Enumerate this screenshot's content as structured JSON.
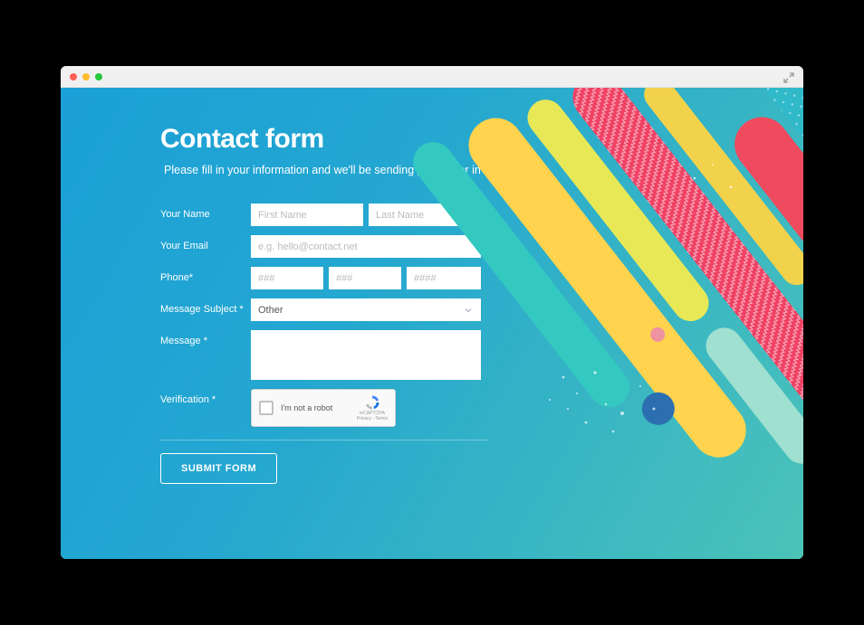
{
  "header": {
    "title": "Contact form",
    "subtitle": "Please fill in your information and we'll be sending your order in no time."
  },
  "form": {
    "name": {
      "label": "Your Name",
      "first_placeholder": "First Name",
      "last_placeholder": "Last Name"
    },
    "email": {
      "label": "Your Email",
      "placeholder": "e.g. hello@contact.net"
    },
    "phone": {
      "label": "Phone*",
      "p1_placeholder": "###",
      "p2_placeholder": "###",
      "p3_placeholder": "####"
    },
    "subject": {
      "label": "Message Subject *",
      "selected": "Other"
    },
    "message": {
      "label": "Message *"
    },
    "verification": {
      "label": "Verification *",
      "captcha_text": "I'm not a robot",
      "captcha_brand": "reCAPTCHA",
      "captcha_links": "Privacy - Terms"
    },
    "submit_label": "SUBMIT FORM"
  }
}
